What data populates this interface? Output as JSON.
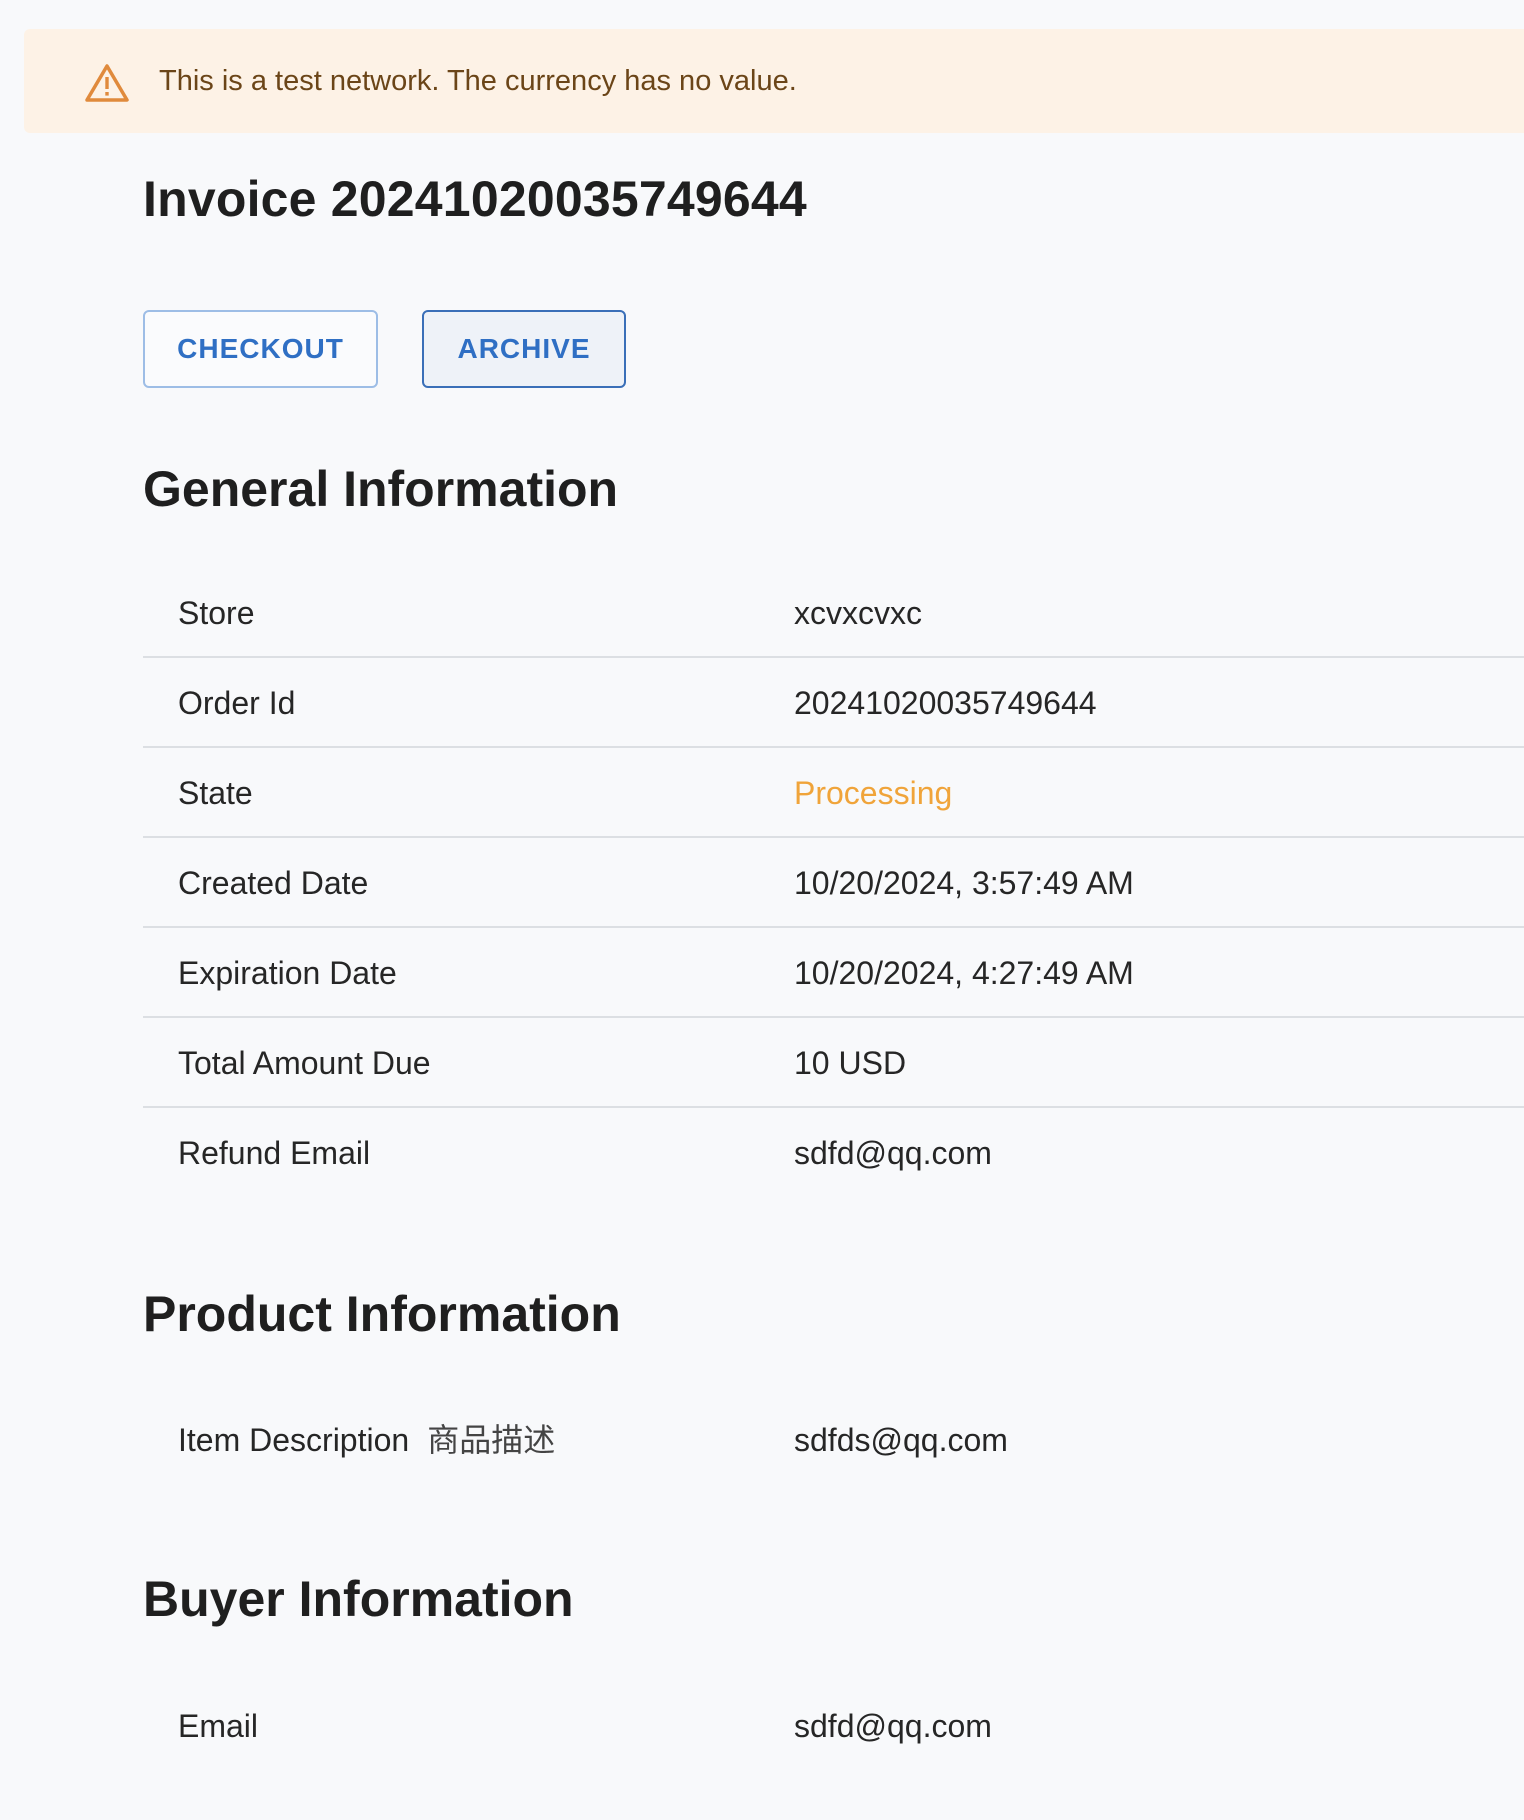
{
  "banner": {
    "icon": "warning-triangle-icon",
    "text": "This is a test network. The currency has no value.",
    "color": "#fdf2e6"
  },
  "invoice": {
    "title": "Invoice 20241020035749644"
  },
  "actions": {
    "checkout_label": "CHECKOUT",
    "archive_label": "ARCHIVE"
  },
  "general": {
    "title": "General Information",
    "rows": [
      {
        "label": "Store",
        "value": "xcvxcvxc"
      },
      {
        "label": "Order Id",
        "value": "20241020035749644"
      },
      {
        "label": "State",
        "value": "Processing",
        "color": "#f0a43a"
      },
      {
        "label": "Created Date",
        "value": "10/20/2024, 3:57:49 AM"
      },
      {
        "label": "Expiration Date",
        "value": "10/20/2024, 4:27:49 AM"
      },
      {
        "label": "Total Amount Due",
        "value": "10 USD"
      },
      {
        "label": "Refund Email",
        "value": "sdfd@qq.com"
      }
    ]
  },
  "product": {
    "title": "Product Information",
    "rows": [
      {
        "label": "Item Description",
        "label_extra": "商品描述",
        "value": "sdfds@qq.com"
      }
    ]
  },
  "buyer": {
    "title": "Buyer Information",
    "rows": [
      {
        "label": "Email",
        "value": "sdfd@qq.com"
      }
    ]
  }
}
